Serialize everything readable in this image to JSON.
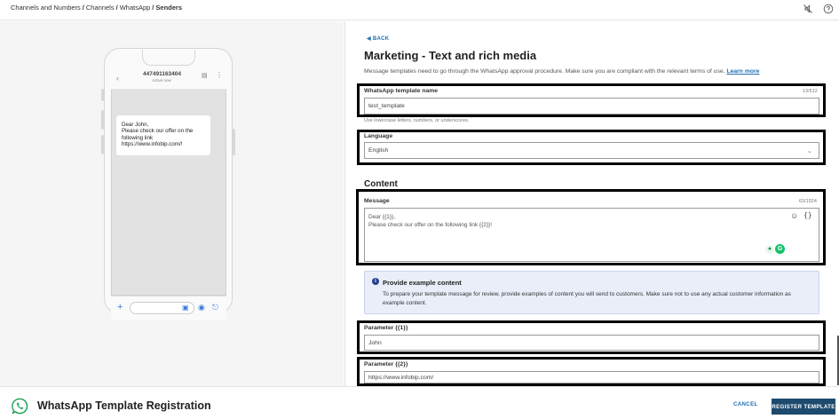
{
  "breadcrumb": {
    "items": [
      "Channels and Numbers",
      "Channels",
      "WhatsApp"
    ],
    "current": "Senders"
  },
  "icons": {
    "mute": "notification-mute-icon",
    "help": "help-circle-icon"
  },
  "preview": {
    "number": "447491163404",
    "status": "Active now",
    "bubble_lines": [
      "Dear John,",
      "Please check our offer on the",
      "following link",
      "https://www.infobip.com/!"
    ]
  },
  "form": {
    "back_label": "BACK",
    "title": "Marketing - Text and rich media",
    "description": "Message templates need to go through the WhatsApp approval procedure. Make sure you are compliant with the relevant terms of use.",
    "learn_more": "Learn more",
    "template_name": {
      "label": "WhatsApp template name",
      "counter": "13/512",
      "value": "test_template",
      "hint": "Use lowercase letters, numbers, or underscores."
    },
    "language": {
      "label": "Language",
      "value": "English"
    },
    "content_title": "Content",
    "message": {
      "label": "Message",
      "counter": "63/1024",
      "line1": "Dear {{1}},",
      "line2": "Please check our offer on the following link {{2}}!"
    },
    "example_info": {
      "title": "Provide example content",
      "body": "To prepare your template message for review, provide examples of content you will send to customers. Make sure not to use any actual customer information as example content."
    },
    "param1": {
      "label": "Parameter {{1}}",
      "value": "John"
    },
    "param2": {
      "label": "Parameter {{2}}",
      "value": "https://www.infobip.com/"
    }
  },
  "footer": {
    "title": "WhatsApp Template Registration",
    "cancel_label": "CANCEL",
    "register_label": "REGISTER TEMPLATE"
  },
  "colors": {
    "accent": "#1f6fb5",
    "primary_button": "#1d4a6d",
    "whatsapp_green": "#25a35a",
    "info_bg": "#e9eef9"
  }
}
